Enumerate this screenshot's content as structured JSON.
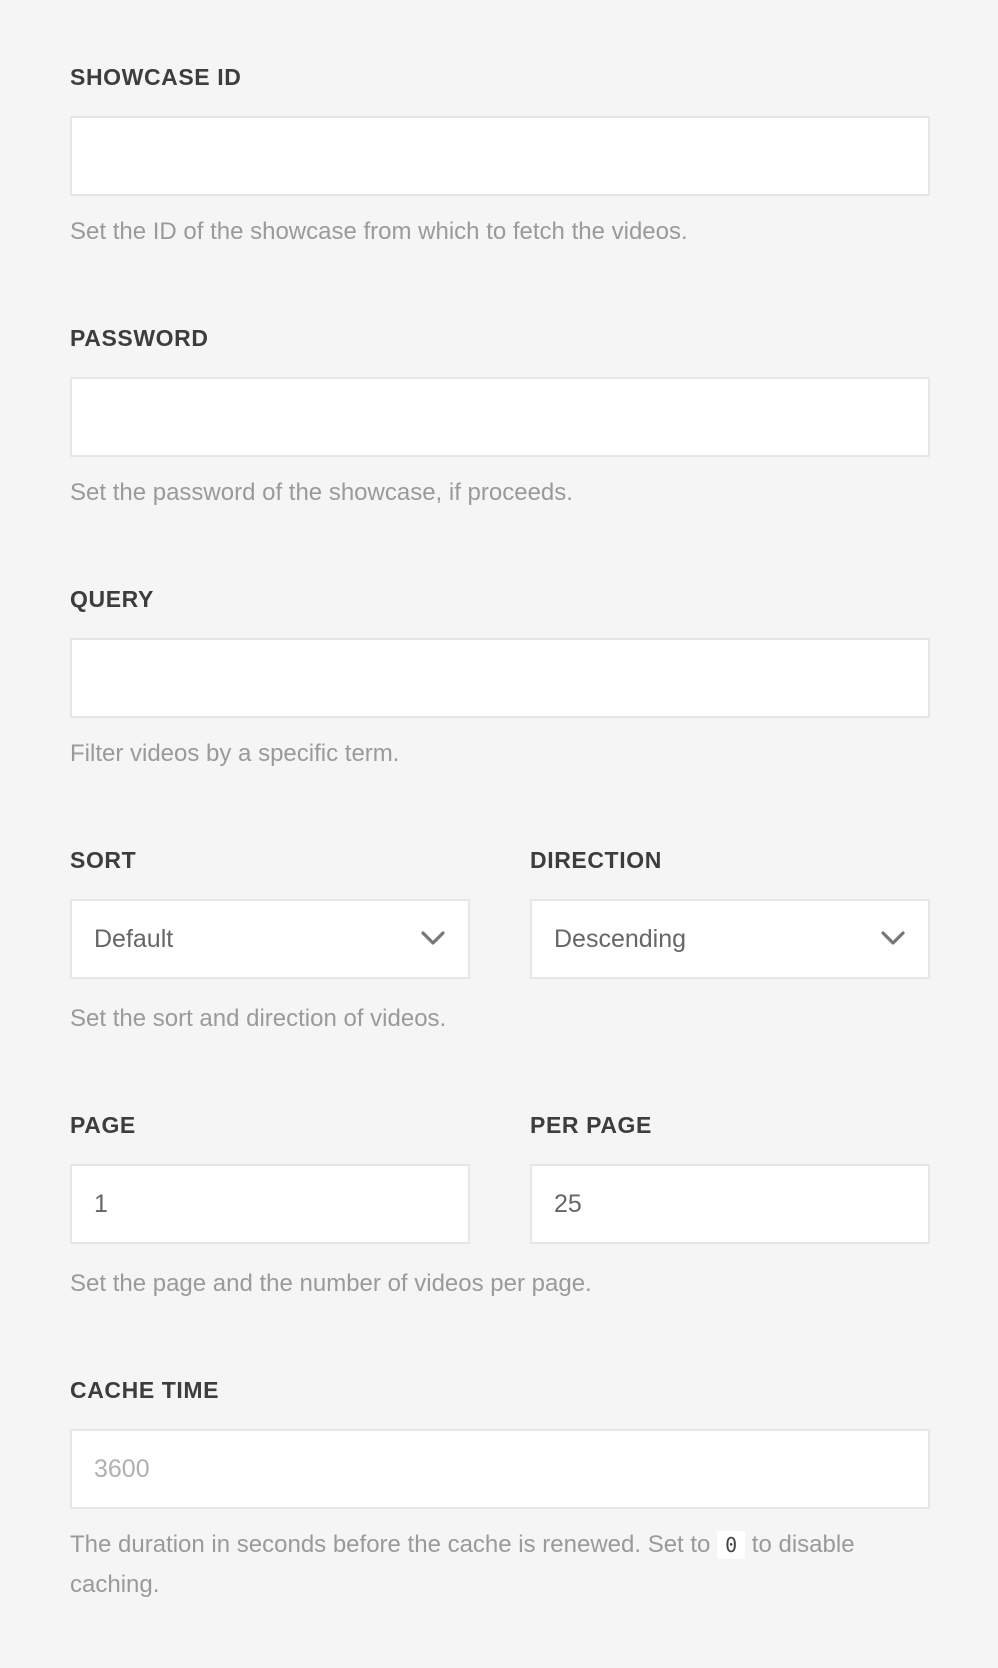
{
  "fields": {
    "showcase_id": {
      "label": "SHOWCASE ID",
      "value": "",
      "help": "Set the ID of the showcase from which to fetch the videos."
    },
    "password": {
      "label": "PASSWORD",
      "value": "",
      "help": "Set the password of the showcase, if proceeds."
    },
    "query": {
      "label": "QUERY",
      "value": "",
      "help": "Filter videos by a specific term."
    },
    "sort": {
      "label": "SORT",
      "selected": "Default"
    },
    "direction": {
      "label": "DIRECTION",
      "selected": "Descending"
    },
    "sort_help": "Set the sort and direction of videos.",
    "page": {
      "label": "PAGE",
      "value": "1"
    },
    "per_page": {
      "label": "PER PAGE",
      "value": "25"
    },
    "page_help": "Set the page and the number of videos per page.",
    "cache_time": {
      "label": "CACHE TIME",
      "placeholder": "3600",
      "help_before": "The duration in seconds before the cache is renewed. Set to",
      "help_code": "0",
      "help_after": "to disable caching."
    }
  },
  "icons": {
    "select_chevron": "chevron-down-icon"
  }
}
